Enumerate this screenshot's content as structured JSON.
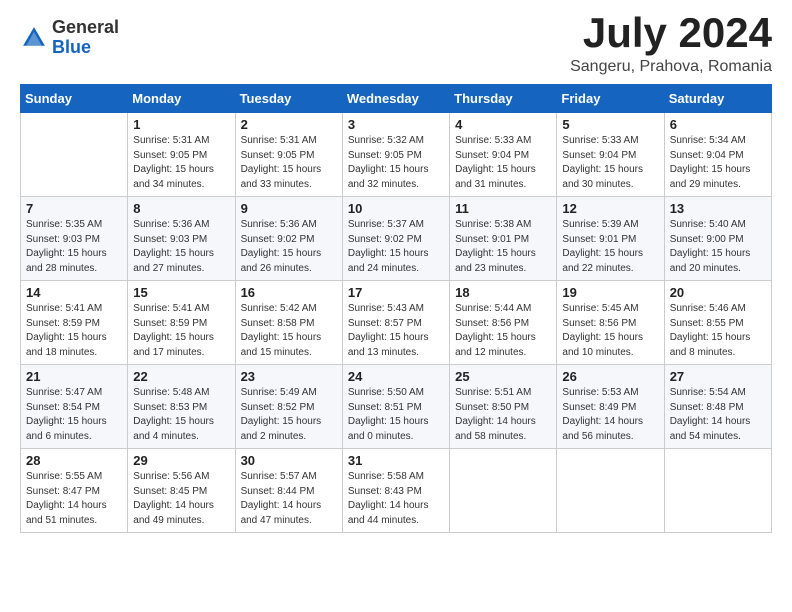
{
  "header": {
    "logo": {
      "general": "General",
      "blue": "Blue"
    },
    "title": "July 2024",
    "location": "Sangeru, Prahova, Romania"
  },
  "days_of_week": [
    "Sunday",
    "Monday",
    "Tuesday",
    "Wednesday",
    "Thursday",
    "Friday",
    "Saturday"
  ],
  "weeks": [
    [
      {
        "day": null,
        "content": null
      },
      {
        "day": "1",
        "content": "Sunrise: 5:31 AM\nSunset: 9:05 PM\nDaylight: 15 hours\nand 34 minutes."
      },
      {
        "day": "2",
        "content": "Sunrise: 5:31 AM\nSunset: 9:05 PM\nDaylight: 15 hours\nand 33 minutes."
      },
      {
        "day": "3",
        "content": "Sunrise: 5:32 AM\nSunset: 9:05 PM\nDaylight: 15 hours\nand 32 minutes."
      },
      {
        "day": "4",
        "content": "Sunrise: 5:33 AM\nSunset: 9:04 PM\nDaylight: 15 hours\nand 31 minutes."
      },
      {
        "day": "5",
        "content": "Sunrise: 5:33 AM\nSunset: 9:04 PM\nDaylight: 15 hours\nand 30 minutes."
      },
      {
        "day": "6",
        "content": "Sunrise: 5:34 AM\nSunset: 9:04 PM\nDaylight: 15 hours\nand 29 minutes."
      }
    ],
    [
      {
        "day": "7",
        "content": "Sunrise: 5:35 AM\nSunset: 9:03 PM\nDaylight: 15 hours\nand 28 minutes."
      },
      {
        "day": "8",
        "content": "Sunrise: 5:36 AM\nSunset: 9:03 PM\nDaylight: 15 hours\nand 27 minutes."
      },
      {
        "day": "9",
        "content": "Sunrise: 5:36 AM\nSunset: 9:02 PM\nDaylight: 15 hours\nand 26 minutes."
      },
      {
        "day": "10",
        "content": "Sunrise: 5:37 AM\nSunset: 9:02 PM\nDaylight: 15 hours\nand 24 minutes."
      },
      {
        "day": "11",
        "content": "Sunrise: 5:38 AM\nSunset: 9:01 PM\nDaylight: 15 hours\nand 23 minutes."
      },
      {
        "day": "12",
        "content": "Sunrise: 5:39 AM\nSunset: 9:01 PM\nDaylight: 15 hours\nand 22 minutes."
      },
      {
        "day": "13",
        "content": "Sunrise: 5:40 AM\nSunset: 9:00 PM\nDaylight: 15 hours\nand 20 minutes."
      }
    ],
    [
      {
        "day": "14",
        "content": "Sunrise: 5:41 AM\nSunset: 8:59 PM\nDaylight: 15 hours\nand 18 minutes."
      },
      {
        "day": "15",
        "content": "Sunrise: 5:41 AM\nSunset: 8:59 PM\nDaylight: 15 hours\nand 17 minutes."
      },
      {
        "day": "16",
        "content": "Sunrise: 5:42 AM\nSunset: 8:58 PM\nDaylight: 15 hours\nand 15 minutes."
      },
      {
        "day": "17",
        "content": "Sunrise: 5:43 AM\nSunset: 8:57 PM\nDaylight: 15 hours\nand 13 minutes."
      },
      {
        "day": "18",
        "content": "Sunrise: 5:44 AM\nSunset: 8:56 PM\nDaylight: 15 hours\nand 12 minutes."
      },
      {
        "day": "19",
        "content": "Sunrise: 5:45 AM\nSunset: 8:56 PM\nDaylight: 15 hours\nand 10 minutes."
      },
      {
        "day": "20",
        "content": "Sunrise: 5:46 AM\nSunset: 8:55 PM\nDaylight: 15 hours\nand 8 minutes."
      }
    ],
    [
      {
        "day": "21",
        "content": "Sunrise: 5:47 AM\nSunset: 8:54 PM\nDaylight: 15 hours\nand 6 minutes."
      },
      {
        "day": "22",
        "content": "Sunrise: 5:48 AM\nSunset: 8:53 PM\nDaylight: 15 hours\nand 4 minutes."
      },
      {
        "day": "23",
        "content": "Sunrise: 5:49 AM\nSunset: 8:52 PM\nDaylight: 15 hours\nand 2 minutes."
      },
      {
        "day": "24",
        "content": "Sunrise: 5:50 AM\nSunset: 8:51 PM\nDaylight: 15 hours\nand 0 minutes."
      },
      {
        "day": "25",
        "content": "Sunrise: 5:51 AM\nSunset: 8:50 PM\nDaylight: 14 hours\nand 58 minutes."
      },
      {
        "day": "26",
        "content": "Sunrise: 5:53 AM\nSunset: 8:49 PM\nDaylight: 14 hours\nand 56 minutes."
      },
      {
        "day": "27",
        "content": "Sunrise: 5:54 AM\nSunset: 8:48 PM\nDaylight: 14 hours\nand 54 minutes."
      }
    ],
    [
      {
        "day": "28",
        "content": "Sunrise: 5:55 AM\nSunset: 8:47 PM\nDaylight: 14 hours\nand 51 minutes."
      },
      {
        "day": "29",
        "content": "Sunrise: 5:56 AM\nSunset: 8:45 PM\nDaylight: 14 hours\nand 49 minutes."
      },
      {
        "day": "30",
        "content": "Sunrise: 5:57 AM\nSunset: 8:44 PM\nDaylight: 14 hours\nand 47 minutes."
      },
      {
        "day": "31",
        "content": "Sunrise: 5:58 AM\nSunset: 8:43 PM\nDaylight: 14 hours\nand 44 minutes."
      },
      {
        "day": null,
        "content": null
      },
      {
        "day": null,
        "content": null
      },
      {
        "day": null,
        "content": null
      }
    ]
  ]
}
